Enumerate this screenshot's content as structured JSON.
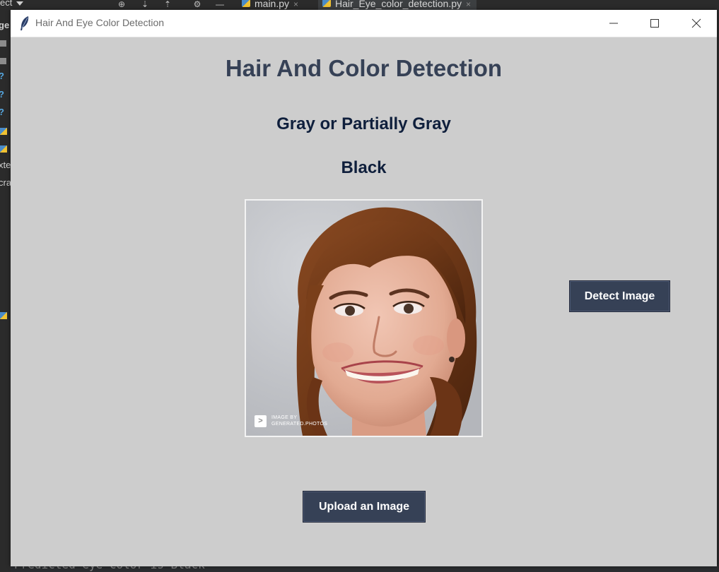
{
  "ide": {
    "dropdown_label": "ect",
    "tabs": [
      {
        "label": "main.py",
        "close": "×"
      },
      {
        "label": "Hair_Eye_color_detection.py",
        "close": "×"
      }
    ],
    "left_fragments": [
      "ge",
      "xte",
      "cra"
    ],
    "console_text": "Predicted eye color is Black"
  },
  "window": {
    "title": "Hair And Eye Color Detection",
    "controls": {
      "minimize": "minimize",
      "maximize": "maximize",
      "close": "close"
    }
  },
  "app": {
    "heading": "Hair And Color Detection",
    "hair_result": "Gray or Partially Gray",
    "eye_result": "Black",
    "image_watermark": {
      "line1": "IMAGE BY",
      "line2": "GENERATED.PHOTOS",
      "badge": ">"
    },
    "detect_button": "Detect Image",
    "upload_button": "Upload an Image"
  },
  "colors": {
    "window_bg": "#cdcdcd",
    "heading": "#364156",
    "result_text": "#0f1f3c",
    "button_bg": "#364156",
    "button_text": "#ffffff"
  }
}
